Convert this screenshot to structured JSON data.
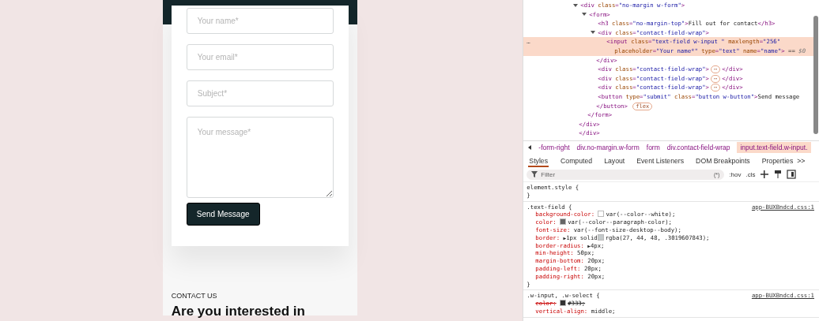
{
  "site": {
    "fields": [
      {
        "kind": "input",
        "placeholder": "Your name*"
      },
      {
        "kind": "input",
        "placeholder": "Your email*"
      },
      {
        "kind": "input",
        "placeholder": "Subject*"
      },
      {
        "kind": "textarea",
        "placeholder": "Your message*"
      }
    ],
    "submit": "Send Message",
    "eyebrow": "CONTACT US",
    "heading": "Are you interested in"
  },
  "devtools": {
    "tree": [
      {
        "expanded": true,
        "selected": false,
        "parts": [
          {
            "kind": "tag",
            "text": "<div "
          },
          {
            "kind": "attr",
            "text": "class"
          },
          {
            "kind": "tag",
            "text": "="
          },
          {
            "kind": "value",
            "text": "\"no-margin w-form\""
          },
          {
            "kind": "tag",
            "text": ">"
          }
        ],
        "close": "</div>",
        "children": [
          {
            "expanded": true,
            "selected": false,
            "parts": [
              {
                "kind": "tag",
                "text": "<form>"
              }
            ],
            "close": "</form>",
            "children": [
              {
                "selected": false,
                "parts": [
                  {
                    "kind": "tag",
                    "text": "<h3 "
                  },
                  {
                    "kind": "attr",
                    "text": "class"
                  },
                  {
                    "kind": "tag",
                    "text": "="
                  },
                  {
                    "kind": "value",
                    "text": "\"no-margin-top\""
                  },
                  {
                    "kind": "tag",
                    "text": ">"
                  },
                  {
                    "kind": "text",
                    "text": "Fill out for contact"
                  },
                  {
                    "kind": "tag",
                    "text": "</h3>"
                  }
                ]
              },
              {
                "expanded": true,
                "selected": false,
                "parts": [
                  {
                    "kind": "tag",
                    "text": "<div "
                  },
                  {
                    "kind": "attr",
                    "text": "class"
                  },
                  {
                    "kind": "tag",
                    "text": "="
                  },
                  {
                    "kind": "value",
                    "text": "\"contact-field-wrap\""
                  },
                  {
                    "kind": "tag",
                    "text": ">"
                  }
                ],
                "close": "</div>",
                "children": [
                  {
                    "selected": true,
                    "parts": [
                      {
                        "kind": "tag",
                        "text": "<input "
                      },
                      {
                        "kind": "attr",
                        "text": "class"
                      },
                      {
                        "kind": "tag",
                        "text": "="
                      },
                      {
                        "kind": "value",
                        "text": "\"text-field w-input \""
                      },
                      {
                        "kind": "attr",
                        "text": " maxlength"
                      },
                      {
                        "kind": "tag",
                        "text": "="
                      },
                      {
                        "kind": "value",
                        "text": "\"256\""
                      }
                    ],
                    "parts2": [
                      {
                        "kind": "attr",
                        "text": "placeholder"
                      },
                      {
                        "kind": "tag",
                        "text": "="
                      },
                      {
                        "kind": "value",
                        "text": "\"Your name*\""
                      },
                      {
                        "kind": "attr",
                        "text": " type"
                      },
                      {
                        "kind": "tag",
                        "text": "="
                      },
                      {
                        "kind": "value",
                        "text": "\"text\""
                      },
                      {
                        "kind": "attr",
                        "text": " name"
                      },
                      {
                        "kind": "tag",
                        "text": "="
                      },
                      {
                        "kind": "value",
                        "text": "\"name\""
                      },
                      {
                        "kind": "tag",
                        "text": ">"
                      },
                      {
                        "kind": "text",
                        "text": " == "
                      },
                      {
                        "kind": "ref",
                        "text": "$0"
                      }
                    ],
                    "gutter": "…"
                  }
                ]
              },
              {
                "expanded": false,
                "selected": false,
                "parts": [
                  {
                    "kind": "tag",
                    "text": "<div "
                  },
                  {
                    "kind": "attr",
                    "text": "class"
                  },
                  {
                    "kind": "tag",
                    "text": "="
                  },
                  {
                    "kind": "value",
                    "text": "\"contact-field-wrap\""
                  },
                  {
                    "kind": "tag",
                    "text": ">"
                  }
                ],
                "badge": "⋯",
                "close": "</div>"
              },
              {
                "expanded": false,
                "selected": false,
                "parts": [
                  {
                    "kind": "tag",
                    "text": "<div "
                  },
                  {
                    "kind": "attr",
                    "text": "class"
                  },
                  {
                    "kind": "tag",
                    "text": "="
                  },
                  {
                    "kind": "value",
                    "text": "\"contact-field-wrap\""
                  },
                  {
                    "kind": "tag",
                    "text": ">"
                  }
                ],
                "badge": "⋯",
                "close": "</div>"
              },
              {
                "expanded": false,
                "selected": false,
                "parts": [
                  {
                    "kind": "tag",
                    "text": "<div "
                  },
                  {
                    "kind": "attr",
                    "text": "class"
                  },
                  {
                    "kind": "tag",
                    "text": "="
                  },
                  {
                    "kind": "value",
                    "text": "\"contact-field-wrap\""
                  },
                  {
                    "kind": "tag",
                    "text": ">"
                  }
                ],
                "badge": "⋯",
                "close": "</div>"
              },
              {
                "selected": false,
                "parts": [
                  {
                    "kind": "tag",
                    "text": "<button "
                  },
                  {
                    "kind": "attr",
                    "text": "type"
                  },
                  {
                    "kind": "tag",
                    "text": "="
                  },
                  {
                    "kind": "value",
                    "text": "\"submit\""
                  },
                  {
                    "kind": "attr",
                    "text": " class"
                  },
                  {
                    "kind": "tag",
                    "text": "="
                  },
                  {
                    "kind": "value",
                    "text": "\"button w-button\""
                  },
                  {
                    "kind": "tag",
                    "text": ">"
                  },
                  {
                    "kind": "text",
                    "text": "Send message"
                  }
                ],
                "closeLine": "</button>",
                "closeBadge": "flex"
              }
            ]
          }
        ]
      }
    ],
    "trailing": "</div>",
    "breadcrumb": [
      {
        "label": "-form-right",
        "selected": false
      },
      {
        "label": "div.no-margin.w-form",
        "selected": false
      },
      {
        "label": "form",
        "selected": false
      },
      {
        "label": "div.contact-field-wrap",
        "selected": false
      },
      {
        "label": "input.text-field.w-input.",
        "selected": true
      }
    ],
    "tabs": [
      {
        "label": "Styles",
        "selected": true
      },
      {
        "label": "Computed",
        "selected": false
      },
      {
        "label": "Layout",
        "selected": false
      },
      {
        "label": "Event Listeners",
        "selected": false
      },
      {
        "label": "DOM Breakpoints",
        "selected": false
      },
      {
        "label": "Properties",
        "selected": false
      }
    ],
    "more_tabs": ">>",
    "filter": {
      "placeholder": "Filter",
      "regex": "(*)",
      "hov": ":hov",
      "cls": ".cls"
    },
    "rules": [
      {
        "selector": "element.style {",
        "close": "}"
      },
      {
        "selector": ".text-field {",
        "source": "app-BUXBndcd.css:1",
        "close": "}",
        "decls": [
          {
            "prop": "background-color:",
            "value": "var(--color--white);",
            "color": "#ffffff",
            "struck": false
          },
          {
            "prop": "color:",
            "value": "var(--color--paragraph-color);",
            "color": "#666666",
            "struck": false
          },
          {
            "prop": "font-size:",
            "value": "var(--font-size-desktop--body);",
            "struck": false
          },
          {
            "prop": "border:",
            "toggle": "▶",
            "value": "1px solid",
            "color": "#c5cacb",
            "value2": "rgba(27, 44, 48, .3019607843);",
            "struck": false
          },
          {
            "prop": "border-radius:",
            "toggle": "▶",
            "value": "4px;",
            "struck": false
          },
          {
            "prop": "min-height:",
            "value": "50px;",
            "struck": false
          },
          {
            "prop": "margin-bottom:",
            "value": "20px;",
            "struck": false
          },
          {
            "prop": "padding-left:",
            "value": "20px;",
            "struck": false
          },
          {
            "prop": "padding-right:",
            "value": "20px;",
            "struck": false
          }
        ]
      },
      {
        "selector": ".w-input, .w-select {",
        "source": "app-BUXBndcd.css:1",
        "decls": [
          {
            "prop": "color:",
            "value": "#333;",
            "color": "#333333",
            "struck": true
          },
          {
            "prop": "vertical-align:",
            "value": "middle;",
            "struck": false
          }
        ]
      }
    ]
  }
}
